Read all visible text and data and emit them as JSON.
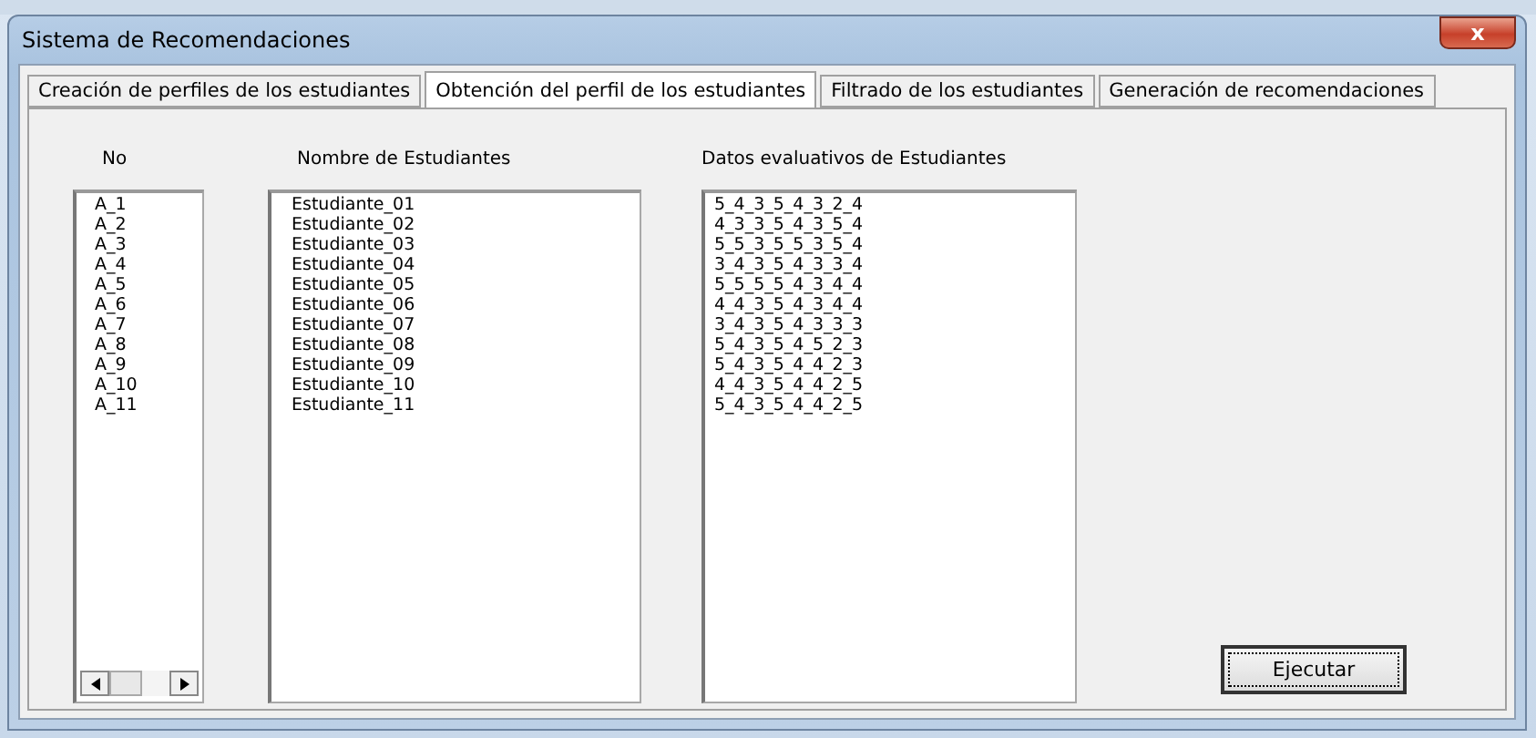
{
  "window": {
    "title": "Sistema de Recomendaciones",
    "close_glyph": "x"
  },
  "tabs": [
    {
      "label": "Creación de perfiles de los estudiantes",
      "selected": false
    },
    {
      "label": "Obtención del perfil de los estudiantes",
      "selected": true
    },
    {
      "label": "Filtrado de los estudiantes",
      "selected": false
    },
    {
      "label": "Generación de recomendaciones",
      "selected": false
    }
  ],
  "lists": [
    {
      "heading": "No",
      "scrollbar": true,
      "items": [
        "A_1",
        "A_2",
        "A_3",
        "A_4",
        "A_5",
        "A_6",
        "A_7",
        "A_8",
        "A_9",
        "A_10",
        "A_11"
      ]
    },
    {
      "heading": "Nombre de Estudiantes",
      "scrollbar": false,
      "items": [
        "Estudiante_01",
        "Estudiante_02",
        "Estudiante_03",
        "Estudiante_04",
        "Estudiante_05",
        "Estudiante_06",
        "Estudiante_07",
        "Estudiante_08",
        "Estudiante_09",
        "Estudiante_10",
        "Estudiante_11"
      ]
    },
    {
      "heading": "Datos evaluativos de Estudiantes",
      "scrollbar": false,
      "items": [
        "5_4_3_5_4_3_2_4",
        "4_3_3_5_4_3_5_4",
        "5_5_3_5_5_3_5_4",
        "3_4_3_5_4_3_3_4",
        "5_5_5_5_4_3_4_4",
        "4_4_3_5_4_3_4_4",
        "3_4_3_5_4_3_3_3",
        "5_4_3_5_4_5_2_3",
        "5_4_3_5_4_4_2_3",
        "4_4_3_5_4_4_2_5",
        "5_4_3_5_4_4_2_5"
      ]
    }
  ],
  "buttons": [
    "Ejecutar"
  ]
}
